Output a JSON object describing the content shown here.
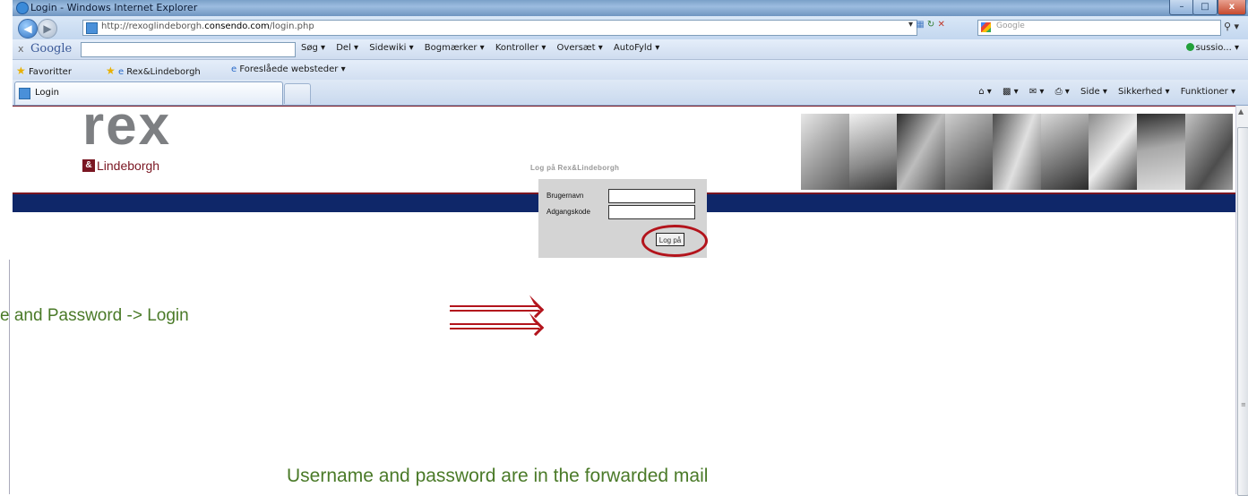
{
  "window": {
    "title": "Login - Windows Internet Explorer",
    "min_label": "–",
    "max_label": "□",
    "close_label": "x"
  },
  "address": {
    "url_prefix": "http://rexoglindeborgh.",
    "url_domain": "consendo.com",
    "url_path": "/login.php",
    "search_placeholder": "Google"
  },
  "google_toolbar": {
    "close": "x",
    "logo": "Google",
    "items": [
      "Søg ▾",
      "Del ▾",
      "Sidewiki ▾",
      "Bogmærker ▾",
      "Kontroller ▾",
      "Oversæt ▾",
      "AutoFyld ▾"
    ],
    "account": "sussio... ▾"
  },
  "favorites_bar": {
    "favorites": "Favoritter",
    "link1": "Rex&Lindeborgh",
    "link2": "Foreslåede websteder ▾"
  },
  "tab": {
    "label": "Login"
  },
  "command_bar": {
    "items": [
      "Side ▾",
      "Sikkerhed ▾",
      "Funktioner ▾"
    ]
  },
  "site": {
    "logo_main": "rex",
    "logo_amp": "&",
    "logo_sub": "Lindeborgh",
    "brand_red": "#7a1622",
    "brand_navy": "#0f2769"
  },
  "login": {
    "title": "Log på Rex&Lindeborgh",
    "username_label": "Brugernavn",
    "password_label": "Adgangskode",
    "button_label": "Log på"
  },
  "annotations": {
    "left_caption": "e and Password -> Login",
    "bottom_caption": "Username and password are in the forwarded mail",
    "highlight_color": "#b3141c",
    "caption_color": "#4a7a28"
  }
}
